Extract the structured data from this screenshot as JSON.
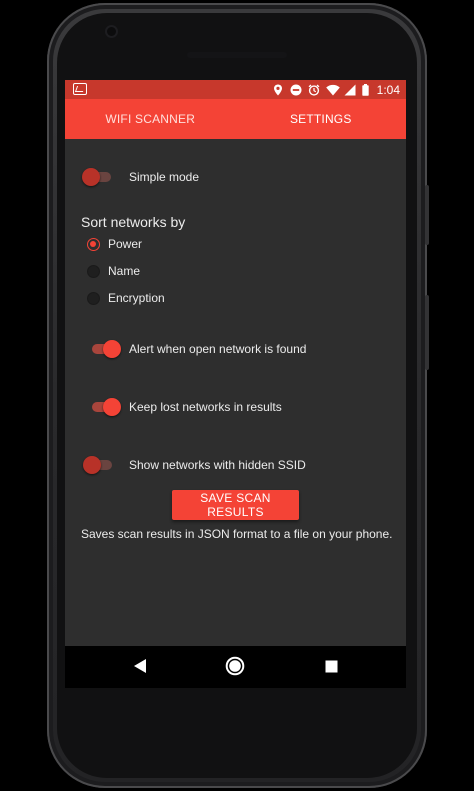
{
  "status_bar": {
    "time": "1:04",
    "icons": [
      "activity-icon",
      "location-icon",
      "dnd-icon",
      "alarm-icon",
      "wifi-icon",
      "signal-icon",
      "battery-icon"
    ]
  },
  "tabs": [
    {
      "label": "WIFI SCANNER",
      "active": false
    },
    {
      "label": "SETTINGS",
      "active": true
    }
  ],
  "settings": {
    "simple_mode": {
      "label": "Simple mode",
      "enabled": false
    },
    "sort": {
      "title": "Sort networks by",
      "options": [
        {
          "label": "Power",
          "selected": true
        },
        {
          "label": "Name",
          "selected": false
        },
        {
          "label": "Encryption",
          "selected": false
        }
      ]
    },
    "alert_open": {
      "label": "Alert when open network is found",
      "enabled": true
    },
    "keep_lost": {
      "label": "Keep lost networks in results",
      "enabled": true
    },
    "hidden_ssid": {
      "label": "Show networks with hidden SSID",
      "enabled": false
    },
    "save_button": {
      "label": "SAVE SCAN RESULTS"
    },
    "save_description": "Saves scan results in JSON format to a file on your phone."
  },
  "colors": {
    "accent": "#f44336",
    "status_bar": "#c7382c",
    "background": "#2e2e2e"
  }
}
